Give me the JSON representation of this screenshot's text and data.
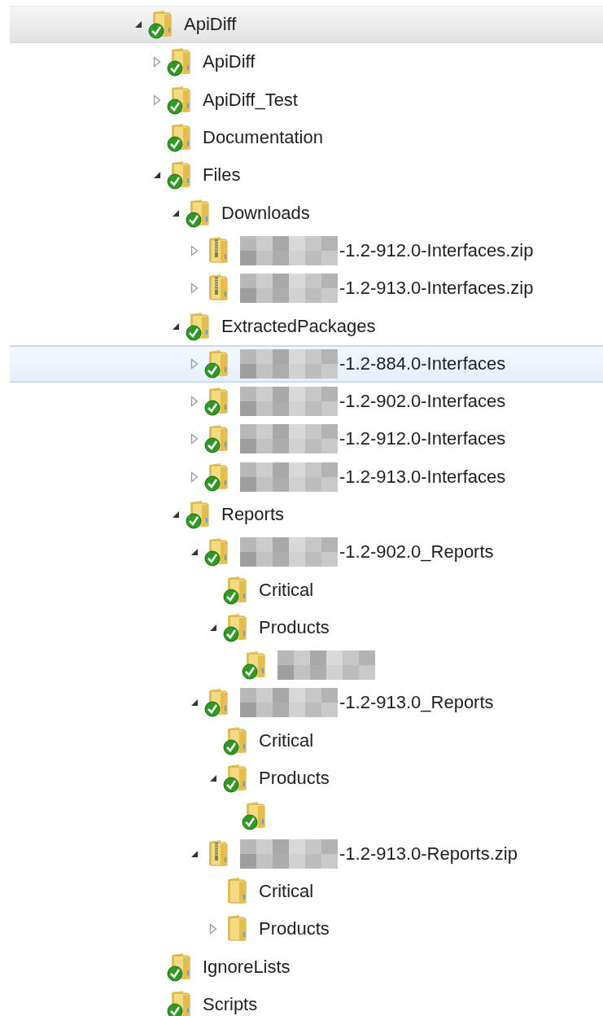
{
  "tree": [
    {
      "label": "ApiDiff",
      "kind": "folder",
      "synced": true,
      "expanded": true,
      "selected": true,
      "hovered": false,
      "children": [
        {
          "label": "ApiDiff",
          "kind": "folder",
          "synced": true,
          "expanded": false,
          "selected": false,
          "hovered": false
        },
        {
          "label": "ApiDiff_Test",
          "kind": "folder",
          "synced": true,
          "expanded": false,
          "selected": false,
          "hovered": false
        },
        {
          "label": "Documentation",
          "kind": "folder",
          "synced": true,
          "selected": false,
          "hovered": false
        },
        {
          "label": "Files",
          "kind": "folder",
          "synced": true,
          "expanded": true,
          "selected": false,
          "hovered": false,
          "children": [
            {
              "label": "Downloads",
              "kind": "folder",
              "synced": true,
              "expanded": true,
              "selected": false,
              "hovered": false,
              "children": [
                {
                  "label": "-1.2-912.0-Interfaces.zip",
                  "redacted": true,
                  "kind": "zip",
                  "synced": false,
                  "expanded": false,
                  "selected": false,
                  "hovered": false
                },
                {
                  "label": "-1.2-913.0-Interfaces.zip",
                  "redacted": true,
                  "kind": "zip",
                  "synced": false,
                  "expanded": false,
                  "selected": false,
                  "hovered": false
                }
              ]
            },
            {
              "label": "ExtractedPackages",
              "kind": "folder",
              "synced": true,
              "expanded": true,
              "selected": false,
              "hovered": false,
              "children": [
                {
                  "label": "-1.2-884.0-Interfaces",
                  "redacted": true,
                  "kind": "folder",
                  "synced": true,
                  "expanded": false,
                  "selected": false,
                  "hovered": true
                },
                {
                  "label": "-1.2-902.0-Interfaces",
                  "redacted": true,
                  "kind": "folder",
                  "synced": true,
                  "expanded": false,
                  "selected": false,
                  "hovered": false
                },
                {
                  "label": "-1.2-912.0-Interfaces",
                  "redacted": true,
                  "kind": "folder",
                  "synced": true,
                  "expanded": false,
                  "selected": false,
                  "hovered": false
                },
                {
                  "label": "-1.2-913.0-Interfaces",
                  "redacted": true,
                  "kind": "folder",
                  "synced": true,
                  "expanded": false,
                  "selected": false,
                  "hovered": false
                }
              ]
            },
            {
              "label": "Reports",
              "kind": "folder",
              "synced": true,
              "expanded": true,
              "selected": false,
              "hovered": false,
              "children": [
                {
                  "label": "-1.2-902.0_Reports",
                  "redacted": true,
                  "kind": "folder",
                  "synced": true,
                  "expanded": true,
                  "selected": false,
                  "hovered": false,
                  "children": [
                    {
                      "label": "Critical",
                      "kind": "folder",
                      "synced": true,
                      "selected": false,
                      "hovered": false
                    },
                    {
                      "label": "Products",
                      "kind": "folder",
                      "synced": true,
                      "expanded": true,
                      "selected": false,
                      "hovered": false,
                      "children": [
                        {
                          "redacted": true,
                          "kind": "folder",
                          "synced": true,
                          "selected": false,
                          "hovered": false
                        }
                      ]
                    }
                  ]
                },
                {
                  "label": "-1.2-913.0_Reports",
                  "redacted": true,
                  "kind": "folder",
                  "synced": true,
                  "expanded": true,
                  "selected": false,
                  "hovered": false,
                  "children": [
                    {
                      "label": "Critical",
                      "kind": "folder",
                      "synced": true,
                      "selected": false,
                      "hovered": false
                    },
                    {
                      "label": "Products",
                      "kind": "folder",
                      "synced": true,
                      "expanded": true,
                      "selected": false,
                      "hovered": false,
                      "children": [
                        {
                          "kind": "folder",
                          "synced": true,
                          "selected": false,
                          "hovered": false
                        }
                      ]
                    }
                  ]
                },
                {
                  "label": "-1.2-913.0-Reports.zip",
                  "redacted": true,
                  "kind": "zip",
                  "synced": false,
                  "expanded": true,
                  "selected": false,
                  "hovered": false,
                  "children": [
                    {
                      "label": "Critical",
                      "kind": "folder",
                      "synced": false,
                      "selected": false,
                      "hovered": false
                    },
                    {
                      "label": "Products",
                      "kind": "folder",
                      "synced": false,
                      "expanded": false,
                      "selected": false,
                      "hovered": false
                    }
                  ]
                }
              ]
            }
          ]
        },
        {
          "label": "IgnoreLists",
          "kind": "folder",
          "synced": true,
          "selected": false,
          "hovered": false
        },
        {
          "label": "Scripts",
          "kind": "folder",
          "synced": true,
          "selected": false,
          "hovered": false
        }
      ]
    }
  ]
}
